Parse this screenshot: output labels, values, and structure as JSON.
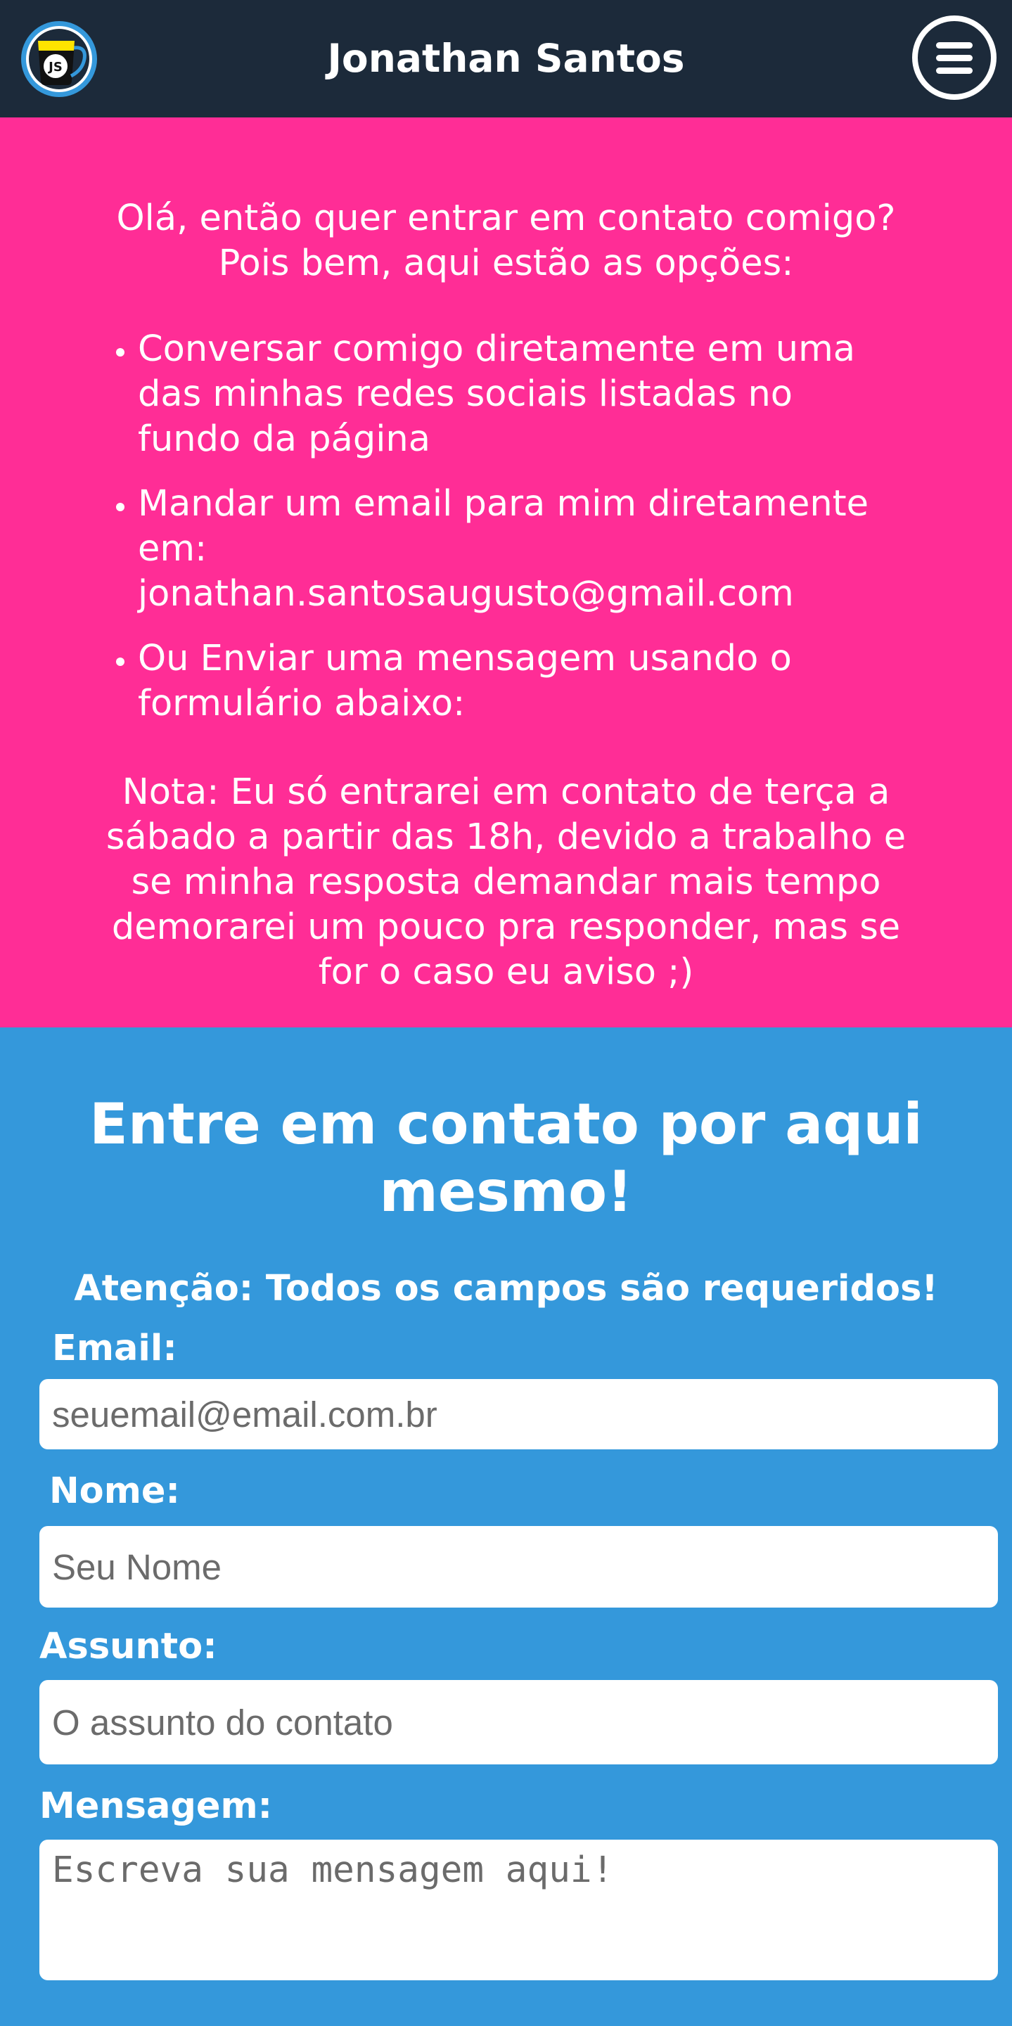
{
  "header": {
    "title": "Jonathan Santos",
    "logo_text": "JS",
    "logo_icon": "coffee-mug-icon",
    "menu_icon": "hamburger-menu-icon"
  },
  "info": {
    "intro_line1": "Olá, então quer entrar em contato comigo?",
    "intro_line2": "Pois bem, aqui estão as opções:",
    "options": [
      "Conversar comigo diretamente em uma das minhas redes sociais listadas no fundo da página",
      "Mandar um email para mim diretamente em: jonathan.santosaugusto@gmail.com",
      "Ou Enviar uma mensagem usando o formulário abaixo:"
    ],
    "note": "Nota: Eu só entrarei em contato de terça a sábado a partir das 18h, devido a trabalho e se minha resposta demandar mais tempo demorarei um pouco pra responder, mas se for o caso eu aviso ;)"
  },
  "contact": {
    "title": "Entre em contato por aqui mesmo!",
    "warning": "Atenção: Todos os campos são requeridos!",
    "fields": {
      "email": {
        "label": "Email:",
        "placeholder": "seuemail@email.com.br"
      },
      "name": {
        "label": "Nome:",
        "placeholder": "Seu Nome"
      },
      "subject": {
        "label": "Assunto:",
        "placeholder": "O assunto do contato"
      },
      "message": {
        "label": "Mensagem:",
        "placeholder": "Escreva sua mensagem aqui!"
      }
    }
  },
  "colors": {
    "header_bg": "#1c2a3a",
    "info_bg": "#ff2d96",
    "contact_bg": "#3498db",
    "logo_yellow": "#ffe400",
    "logo_blue": "#3498db"
  }
}
